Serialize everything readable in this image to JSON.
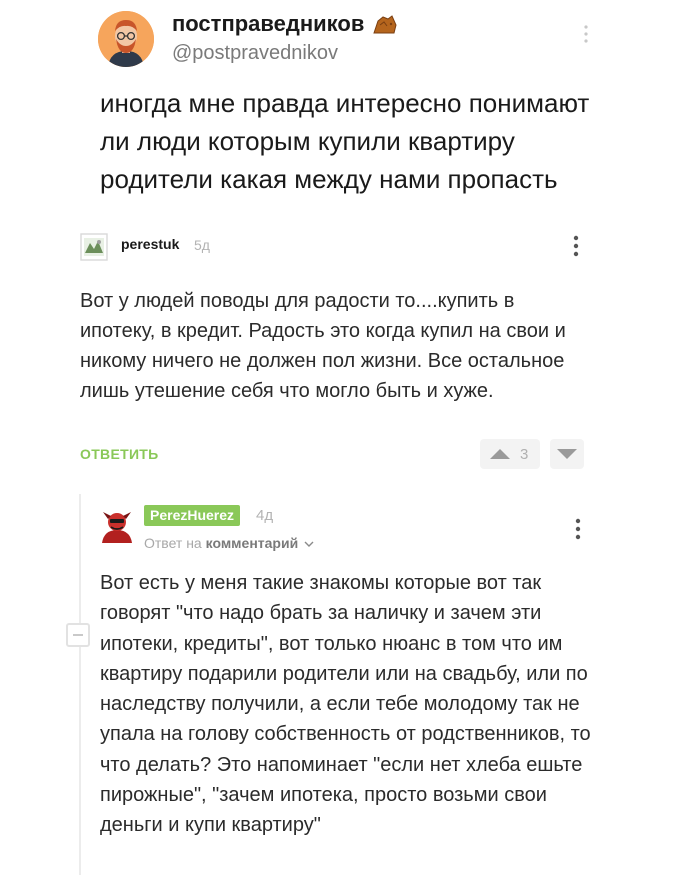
{
  "tweet": {
    "display_name": "постправедников",
    "badge_icon": "rock-emoji-icon",
    "handle": "@postpravednikov",
    "text": "иногда мне правда интересно понимают ли люди которым купили квартиру родители какая между нами пропасть"
  },
  "comment": {
    "username": "perestuk",
    "time": "5д",
    "text": "Вот у людей поводы для радости то....купить в ипотеку, в кредит. Радость это когда купил на свои и никому ничего не должен пол жизни. Все остальное лишь утешение себя что могло быть и хуже.",
    "reply_label": "ОТВЕТИТЬ",
    "rating": "3"
  },
  "reply": {
    "username": "PerezHuerez",
    "time": "4д",
    "reply_prefix": "Ответ на",
    "reply_target": "комментарий",
    "text": "Вот есть у меня такие знакомы которые вот так говорят \"что надо брать за наличку и зачем эти ипотеки, кредиты\", вот только нюанс в том что им квартиру подарили родители или на свадьбу, или по наследству получили, а если тебе молодому так не упала на голову собственность от родственников, то что делать? Это напоминает \"если нет хлеба ешьте пирожные\", \"зачем ипотека, просто возьми свои деньги и купи квартиру\""
  },
  "colors": {
    "accent_green": "#8ac858",
    "muted_text": "#b3b3b3",
    "body_text": "#2b2b2b"
  }
}
